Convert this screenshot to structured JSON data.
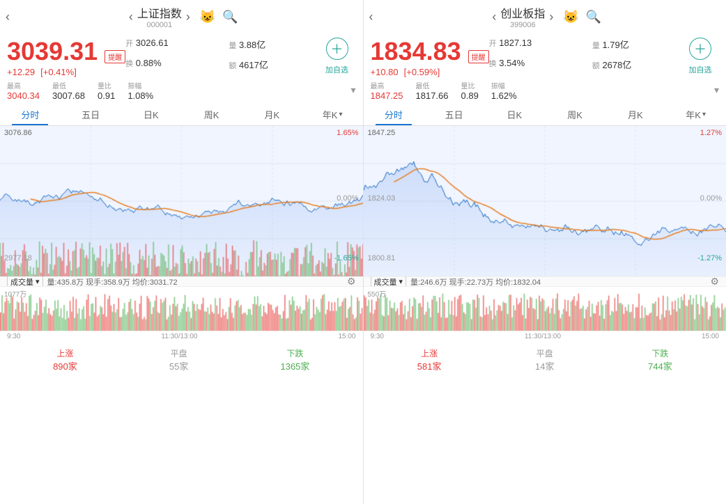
{
  "left": {
    "name": "上证指数",
    "code": "000001",
    "price": "3039.31",
    "change": "+12.29",
    "change_pct": "[+0.41%]",
    "alert": "提醒",
    "open": "3026.61",
    "open_label": "开",
    "volume": "3.88亿",
    "volume_label": "量",
    "换手": "0.88%",
    "换手_label": "换",
    "额": "4617亿",
    "额_label": "额",
    "最高": "3040.34",
    "最低": "3007.68",
    "量比": "0.91",
    "振幅": "1.08%",
    "chart_top_left": "3076.86",
    "chart_top_right": "1.65%",
    "chart_mid_left": "",
    "chart_mid_right": "0.00%",
    "chart_bot_left": "2977.18",
    "chart_bot_right": "-1.65%",
    "vol_label": "1077万",
    "vol_info": "量:435.8万 现手:358.9万 均价:3031.72",
    "times": [
      "9:30",
      "11:30/13:00",
      "15:00"
    ],
    "footer": {
      "up_label": "上涨",
      "up_value": "890家",
      "flat_label": "平盘",
      "flat_value": "55家",
      "down_label": "下跌",
      "down_value": "1365家"
    }
  },
  "right": {
    "name": "创业板指",
    "code": "399006",
    "price": "1834.83",
    "change": "+10.80",
    "change_pct": "[+0.59%]",
    "alert": "提醒",
    "open": "1827.13",
    "open_label": "开",
    "volume": "1.79亿",
    "volume_label": "量",
    "换手": "3.54%",
    "换手_label": "换",
    "额": "2678亿",
    "额_label": "额",
    "最高": "1847.25",
    "最低": "1817.66",
    "量比": "0.89",
    "振幅": "1.62%",
    "chart_top_left": "1847.25",
    "chart_top_right": "1.27%",
    "chart_mid_left": "1824.03",
    "chart_mid_right": "0.00%",
    "chart_bot_left": "1800.81",
    "chart_bot_right": "-1.27%",
    "vol_label": "550万",
    "vol_info": "量:246.6万 现手:22.73万 均价:1832.04",
    "times": [
      "9:30",
      "11:30/13:00",
      "15:00"
    ],
    "footer": {
      "up_label": "上涨",
      "up_value": "581家",
      "flat_label": "平盘",
      "flat_value": "14家",
      "down_label": "下跌",
      "down_value": "744家"
    }
  },
  "tabs": [
    "分时",
    "五日",
    "日K",
    "周K",
    "月K",
    "年K▼"
  ]
}
